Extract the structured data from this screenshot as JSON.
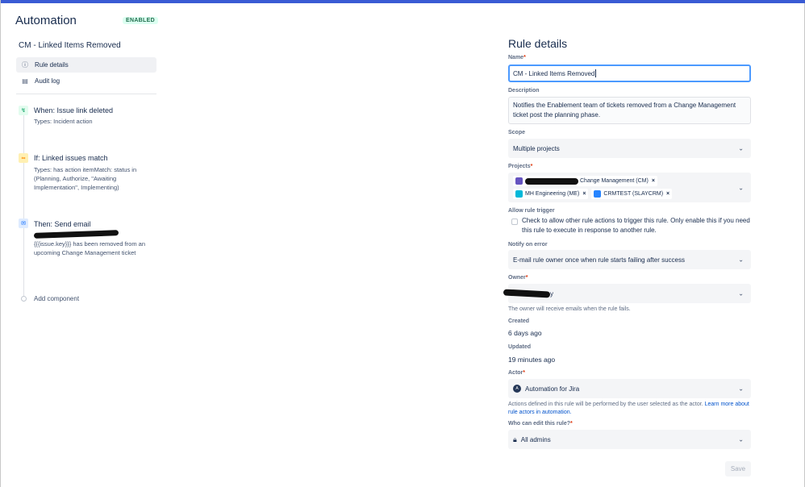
{
  "sidebar": {
    "app_title": "Automation",
    "status_badge": "ENABLED",
    "rule_name": "CM - Linked Items Removed",
    "nav": [
      {
        "label": "Rule details",
        "icon": "info-icon"
      },
      {
        "label": "Audit log",
        "icon": "document-icon"
      }
    ],
    "steps": [
      {
        "title": "When: Issue link deleted",
        "description": "Types: Incident action",
        "icon": "trigger-icon",
        "color": "#36b37e"
      },
      {
        "title": "If: Linked issues match",
        "description": "Types: has action itemMatch: status in (Planning, Authorize, \"Awaiting Implementation\", Implementing)",
        "icon": "link-icon",
        "color": "#ffab00"
      },
      {
        "title": "Then: Send email",
        "description": "{{{issue.key}}} has been removed from an upcoming Change Management ticket",
        "icon": "mail-icon",
        "color": "#0065ff"
      }
    ],
    "add_component": "Add component"
  },
  "details": {
    "title": "Rule details",
    "name_label": "Name",
    "name_value": "CM - Linked Items Removed",
    "description_label": "Description",
    "description_value": "Notifies the Enablement team of tickets removed from a Change Management ticket post the planning phase.",
    "scope_label": "Scope",
    "scope_value": "Multiple projects",
    "projects_label": "Projects",
    "projects": [
      {
        "label": "Change Management (CM)",
        "color": "#6554c0"
      },
      {
        "label": "MH Engineering (ME)",
        "color": "#00b8d9"
      },
      {
        "label": "CRMTEST (SLAYCRM)",
        "color": "#2684ff"
      }
    ],
    "allow_trigger_label": "Allow rule trigger",
    "allow_trigger_text": "Check to allow other rule actions to trigger this rule. Only enable this if you need this rule to execute in response to another rule.",
    "notify_label": "Notify on error",
    "notify_value": "E-mail rule owner once when rule starts failing after success",
    "owner_label": "Owner",
    "owner_value": "y",
    "owner_helper": "The owner will receive emails when the rule fails.",
    "created_label": "Created",
    "created_value": "6 days ago",
    "updated_label": "Updated",
    "updated_value": "19 minutes ago",
    "actor_label": "Actor",
    "actor_value": "Automation for Jira",
    "actor_helper": "Actions defined in this rule will be performed by the user selected as the actor.",
    "actor_link": "Learn more about rule actors in automation.",
    "who_edit_label": "Who can edit this rule?",
    "who_edit_value": "All admins",
    "save_label": "Save"
  },
  "colors": {
    "accent_bar": "#3a5bd4",
    "focus_border": "#4c9aff",
    "enabled_green": "#216e4e"
  }
}
